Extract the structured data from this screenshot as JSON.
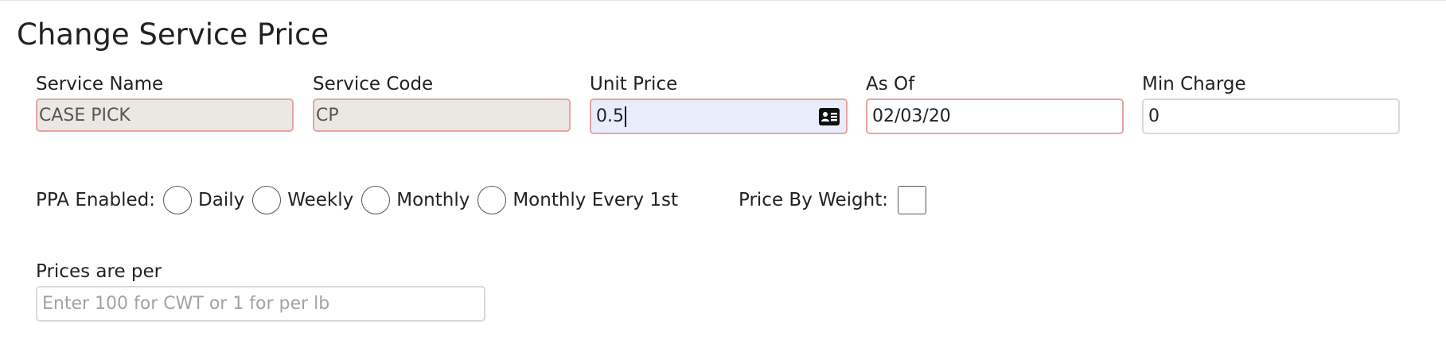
{
  "form": {
    "title": "Change Service Price",
    "fields": {
      "service_name": {
        "label": "Service Name",
        "value": "CASE PICK"
      },
      "service_code": {
        "label": "Service Code",
        "value": "CP"
      },
      "unit_price": {
        "label": "Unit Price",
        "value": "0.5",
        "icon": "contact-card-icon"
      },
      "as_of": {
        "label": "As Of",
        "value": "02/03/20"
      },
      "min_charge": {
        "label": "Min Charge",
        "value": "0"
      }
    },
    "ppa": {
      "label": "PPA Enabled:",
      "options": [
        "Daily",
        "Weekly",
        "Monthly",
        "Monthly Every 1st"
      ]
    },
    "price_by_weight": {
      "label": "Price By Weight:",
      "checked": false
    },
    "prices_per": {
      "label": "Prices are per",
      "value": "",
      "placeholder": "Enter 100 for CWT or 1 for per lb"
    }
  },
  "colors": {
    "invalid_border": "#e8a4a4",
    "readonly_bg": "#ebe8e4",
    "focused_bg": "#e9ecfb"
  }
}
